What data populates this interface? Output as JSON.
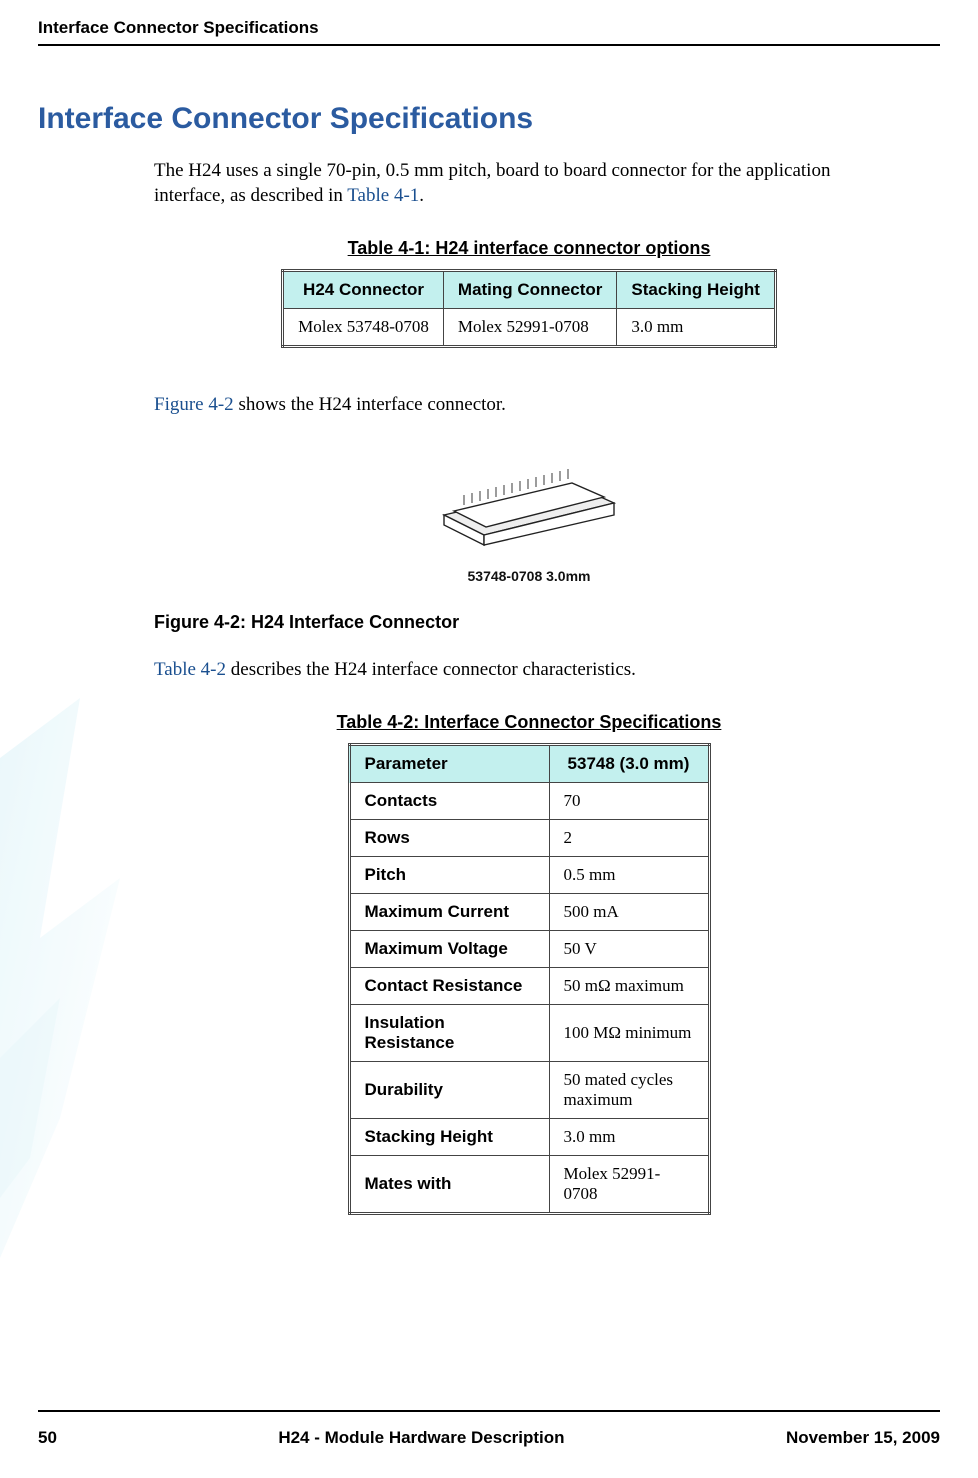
{
  "header": {
    "section_title": "Interface Connector Specifications"
  },
  "main": {
    "title": "Interface Connector Specifications",
    "intro_part1": "The H24 uses a single 70-pin, 0.5 mm pitch, board to board connector for the application interface, as described in ",
    "intro_xref": "Table 4-1",
    "intro_part2": ".",
    "table41": {
      "caption": "Table 4-1: H24 interface connector options",
      "headers": [
        "H24 Connector",
        "Mating Connector",
        "Stacking Height"
      ],
      "row": [
        "Molex 53748-0708",
        "Molex 52991-0708",
        "3.0 mm"
      ]
    },
    "fig_ref_part1_xref": "Figure 4-2",
    "fig_ref_part1_rest": " shows the H24 interface connector.",
    "figure42": {
      "under_label": "53748-0708 3.0mm",
      "caption": "Figure 4-2: H24 Interface Connector"
    },
    "table42_ref_xref": "Table 4-2",
    "table42_ref_rest": " describes the H24 interface connector characteristics.",
    "table42": {
      "caption": "Table 4-2: Interface Connector Specifications",
      "headers": [
        "Parameter",
        "53748 (3.0 mm)"
      ],
      "rows": [
        [
          "Contacts",
          "70"
        ],
        [
          "Rows",
          "2"
        ],
        [
          "Pitch",
          "0.5 mm"
        ],
        [
          "Maximum Current",
          "500 mA"
        ],
        [
          "Maximum Voltage",
          "50 V"
        ],
        [
          "Contact Resistance",
          "50 mΩ maximum"
        ],
        [
          "Insulation Resistance",
          "100 MΩ minimum"
        ],
        [
          "Durability",
          "50 mated cycles maximum"
        ],
        [
          "Stacking Height",
          "3.0 mm"
        ],
        [
          "Mates with",
          "Molex 52991-0708"
        ]
      ]
    }
  },
  "footer": {
    "page_num": "50",
    "doc_title": "H24 - Module Hardware Description",
    "date": "November 15, 2009"
  }
}
